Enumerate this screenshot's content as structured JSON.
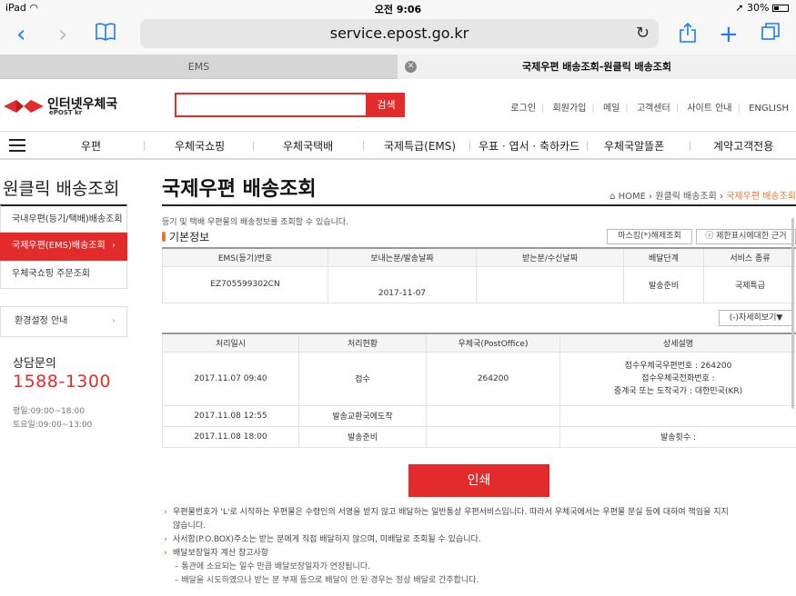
{
  "status": {
    "device": "iPad",
    "time": "오전 9:06",
    "battery": "30%"
  },
  "browser": {
    "url": "service.epost.go.kr",
    "tabs": [
      {
        "label": "EMS"
      },
      {
        "label": "국제우편 배송조회-원클릭 배송조회"
      }
    ]
  },
  "header": {
    "logo_name": "인터넷우체국",
    "logo_sub": "ePOST kr",
    "search_placeholder": "",
    "search_button": "검색",
    "links": [
      "로그인",
      "회원가입",
      "메일",
      "고객센터",
      "사이트 안내",
      "ENGLISH"
    ]
  },
  "gnb": [
    "우편",
    "우체국쇼핑",
    "우체국택배",
    "국제특급(EMS)",
    "우표 · 엽서 · 축하카드",
    "우체국알뜰폰",
    "계약고객전용"
  ],
  "sidebar": {
    "title": "원클릭 배송조회",
    "items": [
      "국내우편(등기/택배)배송조회",
      "국제우편(EMS)배송조회",
      "우체국쇼핑 주문조회"
    ],
    "active_arrow": "›",
    "env": "환경설정 안내",
    "cs_title": "상담문의",
    "cs_phone": "1588-1300",
    "cs_weekday": "평일:09:00~18:00",
    "cs_saturday": "토요일:09:00~13:00"
  },
  "main": {
    "title": "국제우편 배송조회",
    "breadcrumb": {
      "home": "HOME",
      "b1": "원클릭 배송조회",
      "current": "국제우편 배송조회"
    },
    "desc": "등기 및 택배 우편물의 배송정보를 조회할 수 있습니다.",
    "section": "기본정보",
    "btn_masking": "마스킹(*)해제조회",
    "btn_limit": "ⓘ 제한표시에대한 근거",
    "basic": {
      "headers": [
        "EMS(등기)번호",
        "보내는분/발송날짜",
        "받는분/수신날짜",
        "배달단계",
        "서비스 종류"
      ],
      "row": [
        "EZ705599302CN",
        "2017-11-07",
        "",
        "발송준비",
        "국제특급"
      ]
    },
    "detail_toggle": "(-)자세히보기▼",
    "detail": {
      "headers": [
        "처리일시",
        "처리현황",
        "우체국(PostOffice)",
        "상세설명"
      ],
      "rows": [
        [
          "2017.11.07 09:40",
          "접수",
          "264200",
          "접수우체국우편번호 : 264200"
        ],
        [
          "2017.11.08 12:55",
          "발송교환국에도착",
          "",
          ""
        ],
        [
          "2017.11.08 18:00",
          "발송준비",
          "",
          "발송횟수 :"
        ]
      ],
      "row1_extra": [
        "접수우체국전화번호 :",
        "중계국 또는 도착국가 : 대한민국(KR)"
      ]
    },
    "print": "인쇄",
    "notes": [
      "우편물번호가 'L'로 시작하는 우편물은 수령인의 서명을 받지 않고 배달하는 일반통상 우편서비스입니다. 따라서 우체국에서는 우편물 분실 등에 대하여 책임을 지지",
      "않습니다.",
      "사서함(P.O.BOX)주소는 받는 분에게 직접 배달하지 않으며, 미배달로 조회될 수 있습니다.",
      "배달보장일자 계산 참고사항",
      "– 통관에 소요되는 일수 만큼 배달보장일자가 연장됩니다.",
      "– 배달을 시도하였으나 받는 분 부재 등으로 배달이 안 된 경우는 정상 배달로 간주합니다."
    ]
  }
}
